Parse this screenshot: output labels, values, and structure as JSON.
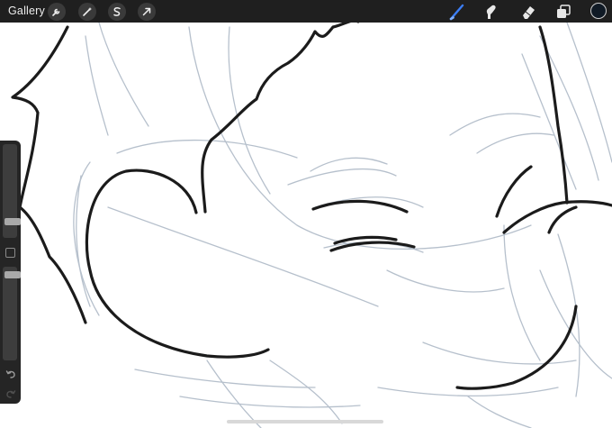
{
  "header": {
    "gallery_label": "Gallery"
  },
  "toolbar_left": {
    "icons": [
      "wrench-icon",
      "magic-wand-icon",
      "selection-s-icon",
      "transform-arrow-icon"
    ]
  },
  "toolbar_right": {
    "icons": [
      "brush-icon",
      "smudge-icon",
      "eraser-icon",
      "layers-icon"
    ],
    "active_tool": "brush-icon",
    "active_color": "#101a25",
    "accent_color": "#3b7df5"
  },
  "sidebar": {
    "brush_size_fraction": 0.15,
    "opacity_fraction": 0.95,
    "icons": [
      "modify-square-icon",
      "undo-icon",
      "redo-icon"
    ]
  }
}
